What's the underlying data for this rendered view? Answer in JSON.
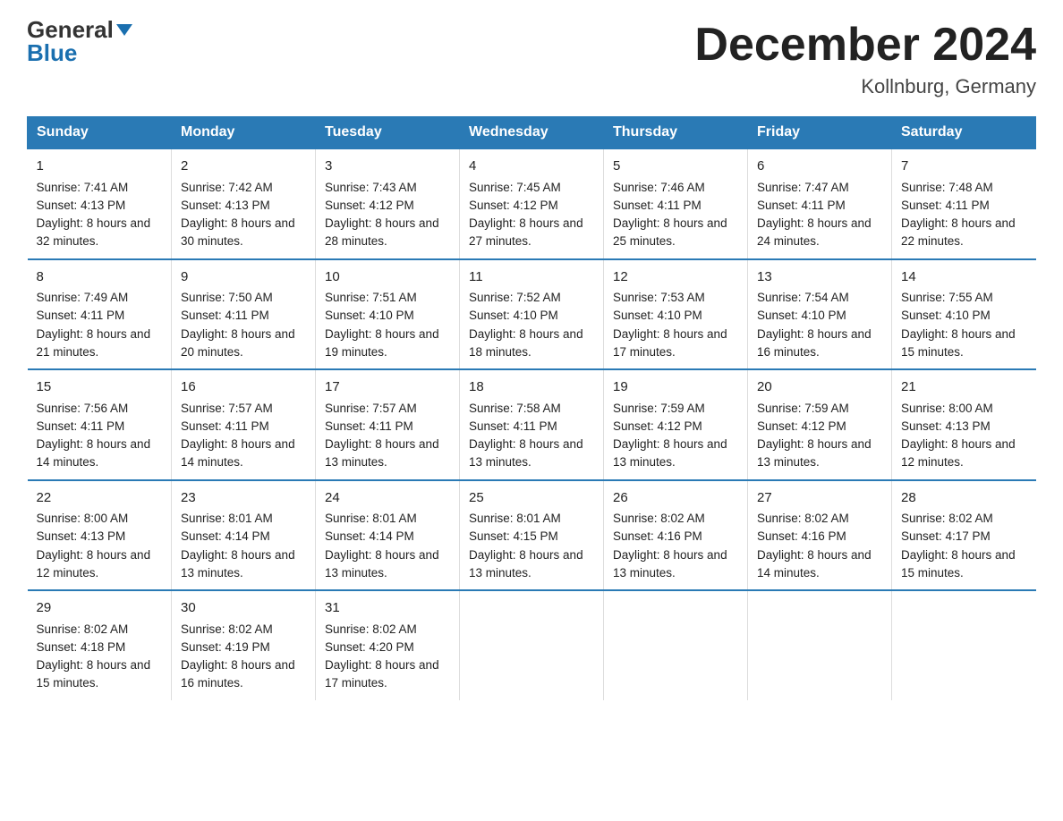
{
  "logo": {
    "part1": "General",
    "part2": "Blue"
  },
  "title": "December 2024",
  "subtitle": "Kollnburg, Germany",
  "days_of_week": [
    "Sunday",
    "Monday",
    "Tuesday",
    "Wednesday",
    "Thursday",
    "Friday",
    "Saturday"
  ],
  "weeks": [
    [
      {
        "date": "1",
        "sunrise": "7:41 AM",
        "sunset": "4:13 PM",
        "daylight": "8 hours and 32 minutes."
      },
      {
        "date": "2",
        "sunrise": "7:42 AM",
        "sunset": "4:13 PM",
        "daylight": "8 hours and 30 minutes."
      },
      {
        "date": "3",
        "sunrise": "7:43 AM",
        "sunset": "4:12 PM",
        "daylight": "8 hours and 28 minutes."
      },
      {
        "date": "4",
        "sunrise": "7:45 AM",
        "sunset": "4:12 PM",
        "daylight": "8 hours and 27 minutes."
      },
      {
        "date": "5",
        "sunrise": "7:46 AM",
        "sunset": "4:11 PM",
        "daylight": "8 hours and 25 minutes."
      },
      {
        "date": "6",
        "sunrise": "7:47 AM",
        "sunset": "4:11 PM",
        "daylight": "8 hours and 24 minutes."
      },
      {
        "date": "7",
        "sunrise": "7:48 AM",
        "sunset": "4:11 PM",
        "daylight": "8 hours and 22 minutes."
      }
    ],
    [
      {
        "date": "8",
        "sunrise": "7:49 AM",
        "sunset": "4:11 PM",
        "daylight": "8 hours and 21 minutes."
      },
      {
        "date": "9",
        "sunrise": "7:50 AM",
        "sunset": "4:11 PM",
        "daylight": "8 hours and 20 minutes."
      },
      {
        "date": "10",
        "sunrise": "7:51 AM",
        "sunset": "4:10 PM",
        "daylight": "8 hours and 19 minutes."
      },
      {
        "date": "11",
        "sunrise": "7:52 AM",
        "sunset": "4:10 PM",
        "daylight": "8 hours and 18 minutes."
      },
      {
        "date": "12",
        "sunrise": "7:53 AM",
        "sunset": "4:10 PM",
        "daylight": "8 hours and 17 minutes."
      },
      {
        "date": "13",
        "sunrise": "7:54 AM",
        "sunset": "4:10 PM",
        "daylight": "8 hours and 16 minutes."
      },
      {
        "date": "14",
        "sunrise": "7:55 AM",
        "sunset": "4:10 PM",
        "daylight": "8 hours and 15 minutes."
      }
    ],
    [
      {
        "date": "15",
        "sunrise": "7:56 AM",
        "sunset": "4:11 PM",
        "daylight": "8 hours and 14 minutes."
      },
      {
        "date": "16",
        "sunrise": "7:57 AM",
        "sunset": "4:11 PM",
        "daylight": "8 hours and 14 minutes."
      },
      {
        "date": "17",
        "sunrise": "7:57 AM",
        "sunset": "4:11 PM",
        "daylight": "8 hours and 13 minutes."
      },
      {
        "date": "18",
        "sunrise": "7:58 AM",
        "sunset": "4:11 PM",
        "daylight": "8 hours and 13 minutes."
      },
      {
        "date": "19",
        "sunrise": "7:59 AM",
        "sunset": "4:12 PM",
        "daylight": "8 hours and 13 minutes."
      },
      {
        "date": "20",
        "sunrise": "7:59 AM",
        "sunset": "4:12 PM",
        "daylight": "8 hours and 13 minutes."
      },
      {
        "date": "21",
        "sunrise": "8:00 AM",
        "sunset": "4:13 PM",
        "daylight": "8 hours and 12 minutes."
      }
    ],
    [
      {
        "date": "22",
        "sunrise": "8:00 AM",
        "sunset": "4:13 PM",
        "daylight": "8 hours and 12 minutes."
      },
      {
        "date": "23",
        "sunrise": "8:01 AM",
        "sunset": "4:14 PM",
        "daylight": "8 hours and 13 minutes."
      },
      {
        "date": "24",
        "sunrise": "8:01 AM",
        "sunset": "4:14 PM",
        "daylight": "8 hours and 13 minutes."
      },
      {
        "date": "25",
        "sunrise": "8:01 AM",
        "sunset": "4:15 PM",
        "daylight": "8 hours and 13 minutes."
      },
      {
        "date": "26",
        "sunrise": "8:02 AM",
        "sunset": "4:16 PM",
        "daylight": "8 hours and 13 minutes."
      },
      {
        "date": "27",
        "sunrise": "8:02 AM",
        "sunset": "4:16 PM",
        "daylight": "8 hours and 14 minutes."
      },
      {
        "date": "28",
        "sunrise": "8:02 AM",
        "sunset": "4:17 PM",
        "daylight": "8 hours and 15 minutes."
      }
    ],
    [
      {
        "date": "29",
        "sunrise": "8:02 AM",
        "sunset": "4:18 PM",
        "daylight": "8 hours and 15 minutes."
      },
      {
        "date": "30",
        "sunrise": "8:02 AM",
        "sunset": "4:19 PM",
        "daylight": "8 hours and 16 minutes."
      },
      {
        "date": "31",
        "sunrise": "8:02 AM",
        "sunset": "4:20 PM",
        "daylight": "8 hours and 17 minutes."
      },
      null,
      null,
      null,
      null
    ]
  ]
}
